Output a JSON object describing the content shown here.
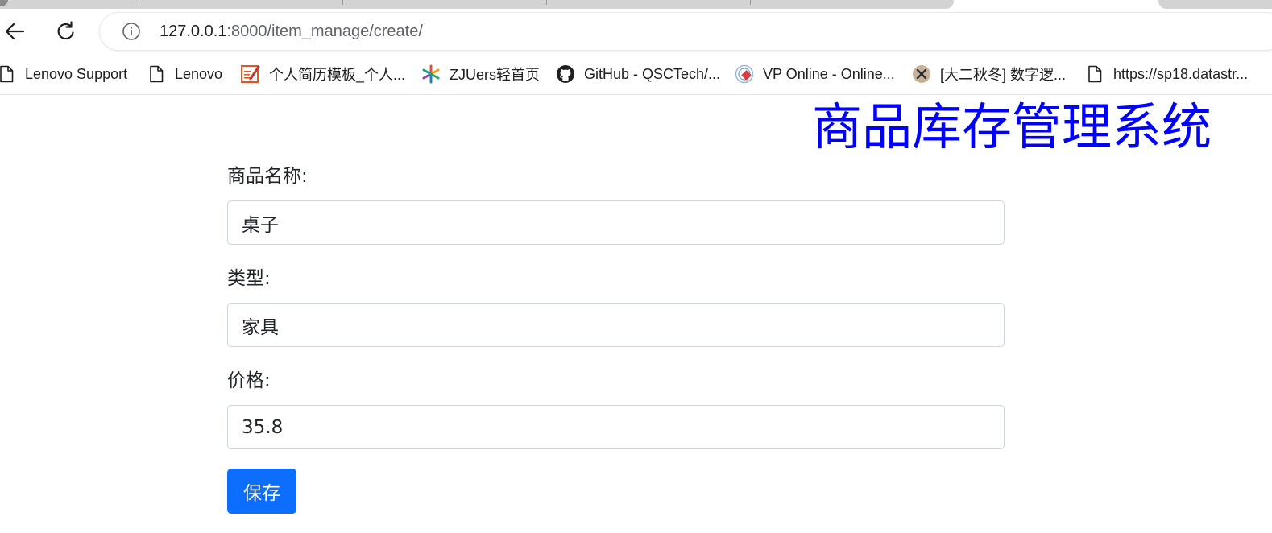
{
  "browser": {
    "url_host": "127.0.0.1",
    "url_rest": ":8000/item_manage/create/",
    "bookmarks": [
      {
        "label": "Lenovo Support",
        "icon": "document-icon"
      },
      {
        "label": "Lenovo",
        "icon": "document-icon"
      },
      {
        "label": "个人简历模板_个人...",
        "icon": "resume-site-icon"
      },
      {
        "label": "ZJUers轻首页",
        "icon": "asterisk-logo-icon"
      },
      {
        "label": "GitHub - QSCTech/...",
        "icon": "github-icon"
      },
      {
        "label": "VP Online - Online...",
        "icon": "vp-online-icon"
      },
      {
        "label": "[大二秋冬] 数字逻...",
        "icon": "avatar-icon"
      },
      {
        "label": "https://sp18.datastr...",
        "icon": "document-icon"
      }
    ]
  },
  "page": {
    "title": "商品库存管理系统",
    "form": {
      "name_label": "商品名称:",
      "name_value": "桌子",
      "type_label": "类型:",
      "type_value": "家具",
      "price_label": "价格:",
      "price_value": "35.8",
      "save_label": "保存"
    }
  },
  "colors": {
    "title": "#0000ff",
    "button": "#0d6efd"
  }
}
